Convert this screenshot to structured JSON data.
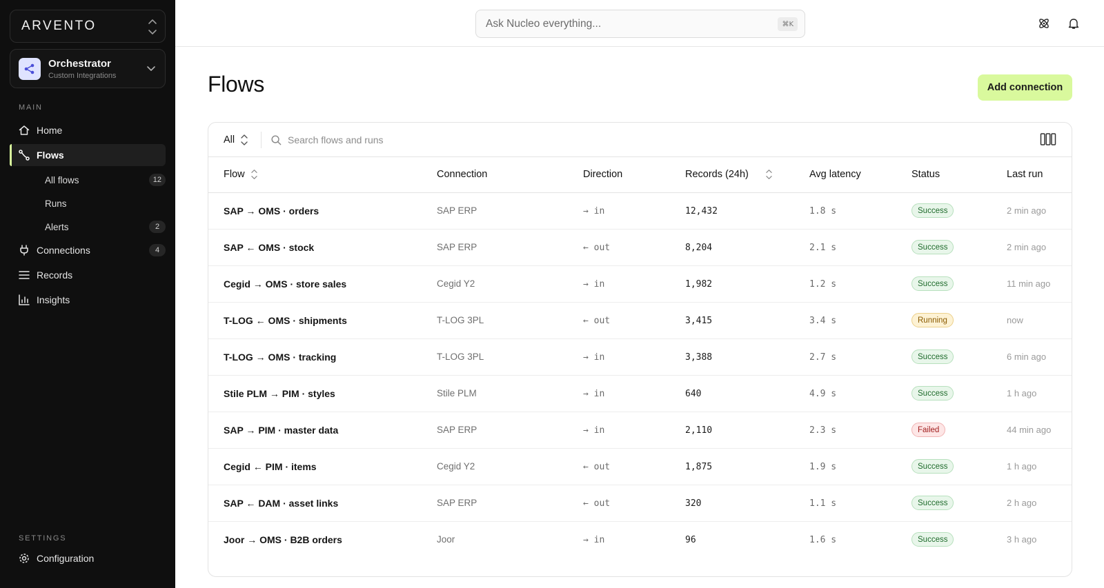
{
  "sidebar": {
    "brand": "ARVENTO",
    "workspace": {
      "title": "Orchestrator",
      "subtitle": "Custom Integrations"
    },
    "main_label": "MAIN",
    "settings_label": "SETTINGS",
    "nav": {
      "home": "Home",
      "flows": "Flows",
      "all_flows": "All flows",
      "all_flows_count": "12",
      "runs": "Runs",
      "alerts": "Alerts",
      "alerts_count": "2",
      "connections": "Connections",
      "connections_count": "4",
      "records": "Records",
      "insights": "Insights",
      "configuration": "Configuration"
    }
  },
  "topbar": {
    "ask_placeholder": "Ask Nucleo everything...",
    "shortcut": "⌘K"
  },
  "page": {
    "title": "Flows",
    "add_button": "Add connection"
  },
  "filter": {
    "scope": "All",
    "search_placeholder": "Search flows and runs"
  },
  "table": {
    "headers": {
      "flow": "Flow",
      "connection": "Connection",
      "direction": "Direction",
      "records": "Records (24h)",
      "latency": "Avg latency",
      "status": "Status",
      "last_run": "Last run"
    },
    "rows": [
      {
        "flow": "SAP → OMS · orders",
        "connection": "SAP ERP",
        "direction": "→ in",
        "records": "12,432",
        "latency": "1.8 s",
        "status": "Success",
        "last_run": "2 min ago"
      },
      {
        "flow": "SAP ← OMS · stock",
        "connection": "SAP ERP",
        "direction": "← out",
        "records": "8,204",
        "latency": "2.1 s",
        "status": "Success",
        "last_run": "2 min ago"
      },
      {
        "flow": "Cegid → OMS · store sales",
        "connection": "Cegid Y2",
        "direction": "→ in",
        "records": "1,982",
        "latency": "1.2 s",
        "status": "Success",
        "last_run": "11 min ago"
      },
      {
        "flow": "T-LOG ← OMS · shipments",
        "connection": "T-LOG 3PL",
        "direction": "← out",
        "records": "3,415",
        "latency": "3.4 s",
        "status": "Running",
        "last_run": "now"
      },
      {
        "flow": "T-LOG → OMS · tracking",
        "connection": "T-LOG 3PL",
        "direction": "→ in",
        "records": "3,388",
        "latency": "2.7 s",
        "status": "Success",
        "last_run": "6 min ago"
      },
      {
        "flow": "Stile PLM → PIM · styles",
        "connection": "Stile PLM",
        "direction": "→ in",
        "records": "640",
        "latency": "4.9 s",
        "status": "Success",
        "last_run": "1 h ago"
      },
      {
        "flow": "SAP → PIM · master data",
        "connection": "SAP ERP",
        "direction": "→ in",
        "records": "2,110",
        "latency": "2.3 s",
        "status": "Failed",
        "last_run": "44 min ago"
      },
      {
        "flow": "Cegid ← PIM · items",
        "connection": "Cegid Y2",
        "direction": "← out",
        "records": "1,875",
        "latency": "1.9 s",
        "status": "Success",
        "last_run": "1 h ago"
      },
      {
        "flow": "SAP ← DAM · asset links",
        "connection": "SAP ERP",
        "direction": "← out",
        "records": "320",
        "latency": "1.1 s",
        "status": "Success",
        "last_run": "2 h ago"
      },
      {
        "flow": "Joor → OMS · B2B orders",
        "connection": "Joor",
        "direction": "→ in",
        "records": "96",
        "latency": "1.6 s",
        "status": "Success",
        "last_run": "3 h ago"
      }
    ]
  },
  "colors": {
    "sidebar_bg": "#0f0f0f",
    "accent": "#d9f99d",
    "success": "#1f6b2c",
    "running": "#8a5a00",
    "failed": "#a11e1e"
  }
}
